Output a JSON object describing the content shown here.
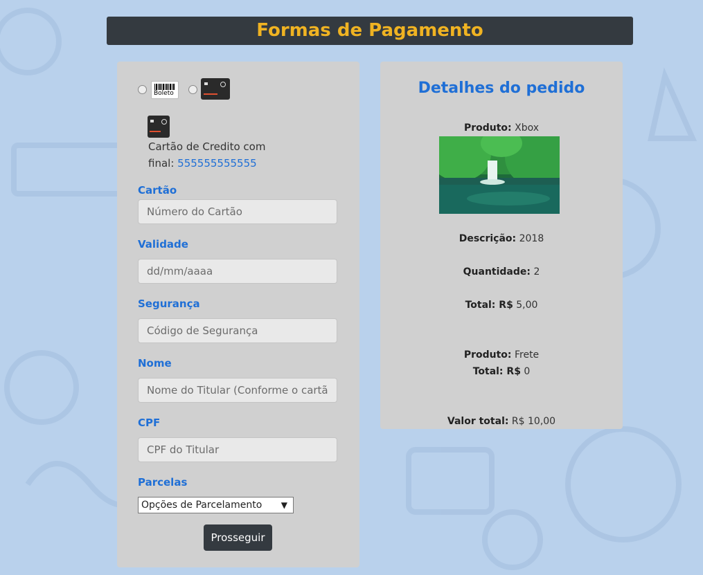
{
  "header": {
    "title": "Formas de Pagamento"
  },
  "payment_options": {
    "boleto_label": "Boleto"
  },
  "saved_card": {
    "line1": "Cartão de Credito com",
    "line2_prefix": "final:",
    "number": "555555555555"
  },
  "form": {
    "card": {
      "label": "Cartão",
      "placeholder": "Número do Cartão"
    },
    "expiry": {
      "label": "Validade",
      "placeholder": "dd/mm/aaaa"
    },
    "security": {
      "label": "Segurança",
      "placeholder": "Código de Segurança"
    },
    "name": {
      "label": "Nome",
      "placeholder": "Nome do Titular (Conforme o cartão)"
    },
    "cpf": {
      "label": "CPF",
      "placeholder": "CPF do Titular"
    },
    "installments": {
      "label": "Parcelas",
      "selected": "Opções de Parcelamento"
    },
    "submit_label": "Prosseguir"
  },
  "order": {
    "title": "Detalhes do pedido",
    "product_label": "Produto:",
    "product_value": "Xbox",
    "description_label": "Descrição:",
    "description_value": "2018",
    "quantity_label": "Quantidade:",
    "quantity_value": "2",
    "total_label": "Total: R$",
    "total_value": "5,00",
    "shipping_label": "Produto:",
    "shipping_value": "Frete",
    "shipping_total_label": "Total: R$",
    "shipping_total_value": "0",
    "grand_total_label": "Valor total:",
    "grand_total_value": "R$ 10,00"
  },
  "colors": {
    "accent": "#1f6fd6",
    "header_bg": "#343a40",
    "header_text": "#f0b322",
    "page_bg": "#b9d1ec"
  }
}
